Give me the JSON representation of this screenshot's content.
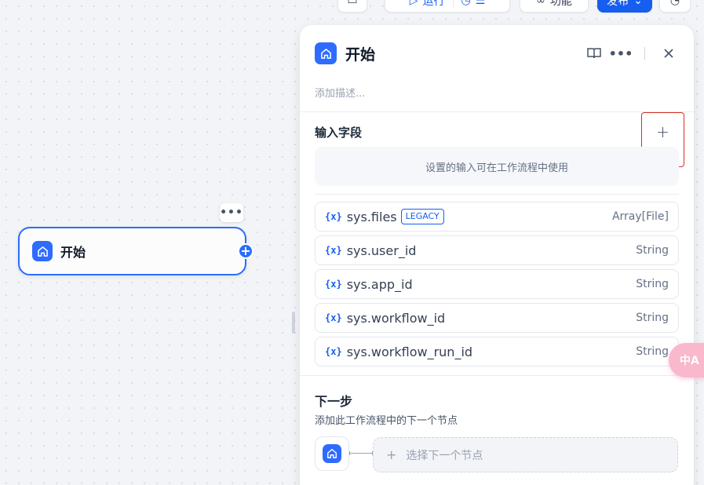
{
  "toolbar": {
    "run_label": "运行",
    "features_label": "功能",
    "publish_label": "发布"
  },
  "canvas": {
    "start_node": {
      "title": "开始",
      "more_label": "•••",
      "add_label": "+"
    }
  },
  "panel": {
    "title": "开始",
    "description_placeholder": "添加描述...",
    "input_fields": {
      "title": "输入字段",
      "add_label": "+",
      "hint": "设置的输入可在工作流程中使用",
      "items": [
        {
          "icon": "{x}",
          "name": "sys.files",
          "badge": "LEGACY",
          "type": "Array[File]"
        },
        {
          "icon": "{x}",
          "name": "sys.user_id",
          "type": "String"
        },
        {
          "icon": "{x}",
          "name": "sys.app_id",
          "type": "String"
        },
        {
          "icon": "{x}",
          "name": "sys.workflow_id",
          "type": "String"
        },
        {
          "icon": "{x}",
          "name": "sys.workflow_run_id",
          "type": "String"
        }
      ]
    },
    "next_step": {
      "title": "下一步",
      "description": "添加此工作流程中的下一个节点",
      "select_label": "选择下一个节点"
    }
  },
  "translate_fab": {
    "label": "中A"
  },
  "icons": [
    "home-icon",
    "book-icon",
    "more-icon",
    "close-icon",
    "plus-icon",
    "variable-icon",
    "play-icon",
    "history-icon",
    "translate-icon"
  ],
  "colors": {
    "accent": "#155eef",
    "node_border": "#296dff",
    "highlight": "#d92d20"
  }
}
